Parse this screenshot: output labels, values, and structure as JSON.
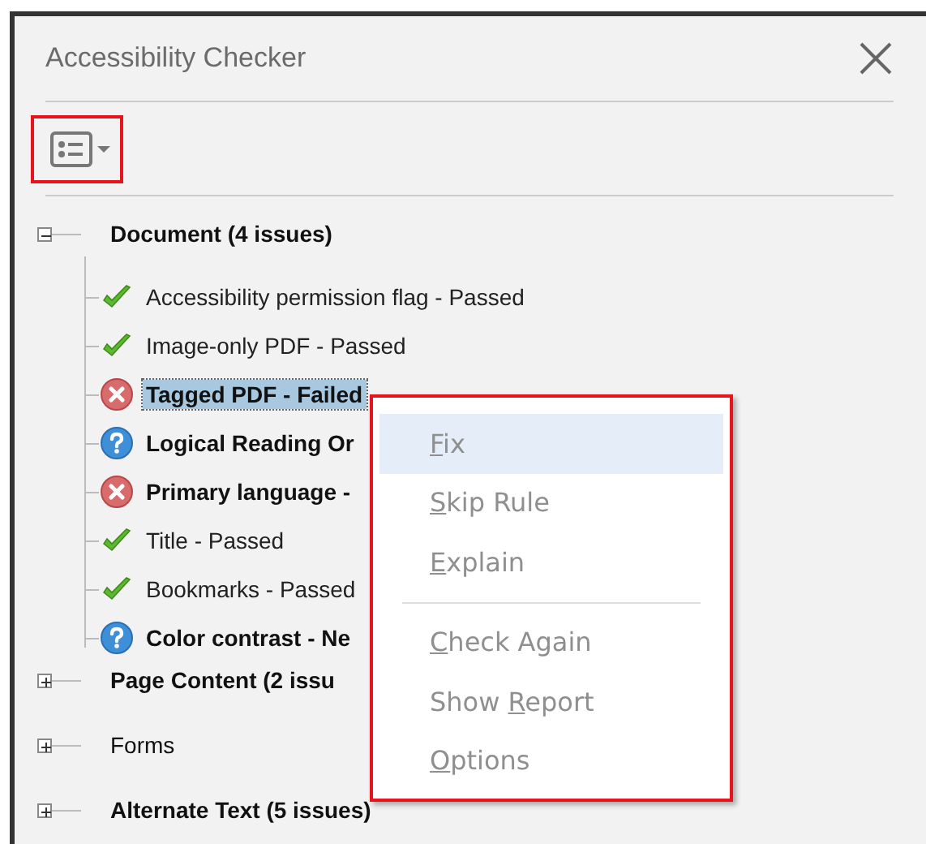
{
  "window": {
    "title": "Accessibility Checker"
  },
  "toolbar": {
    "options_button": {
      "highlighted": true
    }
  },
  "tree": [
    {
      "label": "Document (4 issues)",
      "has_issues": true,
      "expanded": true,
      "children": [
        {
          "label": "Accessibility permission flag - Passed",
          "kind": "passed",
          "selected": false
        },
        {
          "label": "Image-only PDF - Passed",
          "kind": "passed",
          "selected": false
        },
        {
          "label": "Tagged PDF - Failed",
          "kind": "failed",
          "selected": true
        },
        {
          "label": "Logical Reading Or",
          "kind": "question",
          "selected": false
        },
        {
          "label": "Primary language -",
          "kind": "failed",
          "selected": false
        },
        {
          "label": "Title - Passed",
          "kind": "passed",
          "selected": false
        },
        {
          "label": "Bookmarks - Passed",
          "kind": "passed",
          "selected": false
        },
        {
          "label": "Color contrast - Ne",
          "kind": "question",
          "selected": false
        }
      ]
    },
    {
      "label": "Page Content (2 issu",
      "has_issues": true,
      "expanded": false
    },
    {
      "label": "Forms",
      "has_issues": false,
      "expanded": false
    },
    {
      "label": "Alternate Text (5 issues)",
      "has_issues": true,
      "expanded": false
    }
  ],
  "context_menu": {
    "highlighted_border": true,
    "items": [
      {
        "kind": "item",
        "key": "F",
        "post": "ix",
        "highlighted": true
      },
      {
        "kind": "item",
        "key": "S",
        "post": "kip Rule",
        "highlighted": false
      },
      {
        "kind": "item",
        "key": "E",
        "post": "xplain",
        "highlighted": false
      },
      {
        "kind": "separator"
      },
      {
        "kind": "item",
        "key": "C",
        "post": "heck Again",
        "highlighted": false
      },
      {
        "kind": "item",
        "pre": "Show ",
        "key": "R",
        "post": "eport",
        "highlighted": false
      },
      {
        "kind": "item",
        "key": "O",
        "post": "ptions",
        "highlighted": false
      }
    ]
  }
}
